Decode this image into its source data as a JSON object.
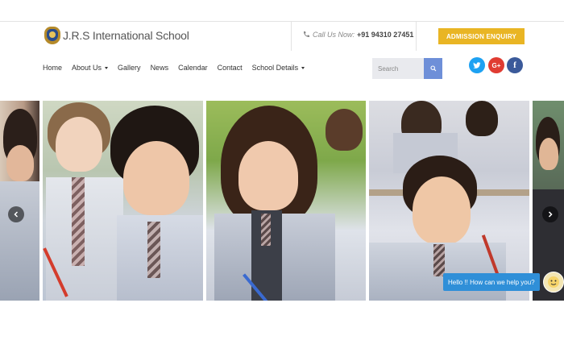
{
  "header": {
    "logo_text": "J.R.S International School",
    "call_label": "Call Us Now:",
    "phone": "+91 94310 27451",
    "enquiry_button": "ADMISSION ENQUIRY"
  },
  "nav": {
    "items": [
      {
        "label": "Home",
        "dropdown": false
      },
      {
        "label": "About Us",
        "dropdown": true
      },
      {
        "label": "Gallery",
        "dropdown": false
      },
      {
        "label": "News",
        "dropdown": false
      },
      {
        "label": "Calendar",
        "dropdown": false
      },
      {
        "label": "Contact",
        "dropdown": false
      },
      {
        "label": "School Details",
        "dropdown": true
      }
    ]
  },
  "search": {
    "placeholder": "Search",
    "icon": "search-icon"
  },
  "social": {
    "twitter": {
      "icon": "twitter-icon",
      "color": "#1da1f2"
    },
    "google_plus": {
      "icon": "google-plus-icon",
      "color": "#e03c32"
    },
    "facebook": {
      "icon": "facebook-icon",
      "color": "#3b5a9a"
    }
  },
  "slider": {
    "slides": [
      "slide-1",
      "slide-2",
      "slide-3",
      "slide-4",
      "slide-5"
    ],
    "prev_icon": "chevron-left-icon",
    "next_icon": "chevron-right-icon"
  },
  "chat": {
    "message": "Hello !! How can we help you?"
  },
  "colors": {
    "accent": "#e9b524",
    "search_button": "#6e8fd8",
    "chat": "#2f8fd8"
  }
}
